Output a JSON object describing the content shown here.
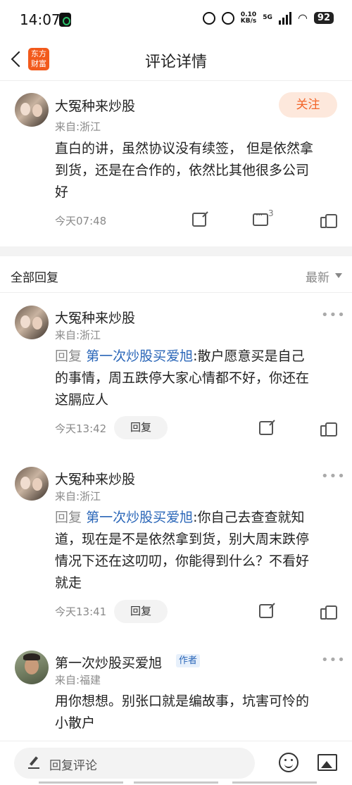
{
  "status": {
    "time": "14:07",
    "net_speed": "0.10",
    "net_unit": "KB/s",
    "net_type": "5G",
    "battery": "92"
  },
  "nav": {
    "logo_line1": "东方",
    "logo_line2": "财富",
    "title": "评论详情"
  },
  "main_comment": {
    "user": "大冤种来炒股",
    "from": "来自:浙江",
    "follow_label": "关注",
    "text_lines": [
      "直白的讲，虽然协议没有续签， 但是依然拿",
      "到货，还是在合作的，依然比其他很多公司",
      "好"
    ],
    "time": "今天07:48",
    "comment_count": "3"
  },
  "replies_section": {
    "title": "全部回复",
    "sort": "最新"
  },
  "replies": [
    {
      "user": "大冤种来炒股",
      "from": "来自:浙江",
      "reply_prefix": "回复",
      "reply_to": "第一次炒股买爱旭",
      "line1_rest": ":散户愿意买是自己",
      "lines": [
        "的事情，周五跌停大家心情都不好，你还在",
        "这膈应人"
      ],
      "time": "今天13:42",
      "reply_label": "回复"
    },
    {
      "user": "大冤种来炒股",
      "from": "来自:浙江",
      "reply_prefix": "回复",
      "reply_to": "第一次炒股买爱旭",
      "line1_rest": ":你自己去查查就知",
      "lines": [
        "道，现在是不是依然拿到货，别大周末跌停",
        "情况下还在这叨叨，你能得到什么？不看好",
        "就走"
      ],
      "time": "今天13:41",
      "reply_label": "回复"
    },
    {
      "user": "第一次炒股买爱旭",
      "from": "来自:福建",
      "author_tag": "作者",
      "lines": [
        "用你想想。别张口就是编故事，坑害可怜的",
        "小散户"
      ]
    }
  ],
  "bottom_bar": {
    "placeholder": "回复评论"
  }
}
